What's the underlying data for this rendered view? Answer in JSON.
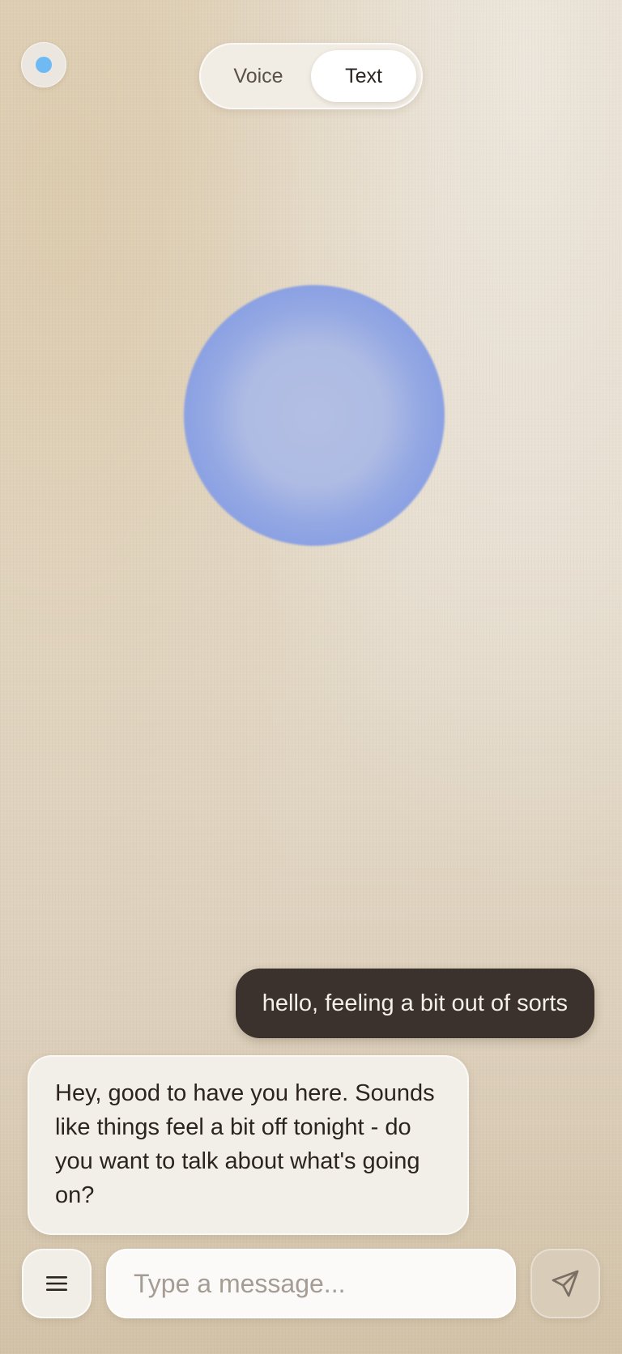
{
  "status": {
    "indicator_icon": "status-dot-icon",
    "color": "#6fbaf3"
  },
  "mode_toggle": {
    "tabs": [
      {
        "label": "Voice",
        "active": false
      },
      {
        "label": "Text",
        "active": true
      }
    ]
  },
  "conversation": {
    "messages": [
      {
        "role": "user",
        "text": "hello, feeling a bit out of sorts"
      },
      {
        "role": "assistant",
        "text": "Hey, good to have you here. Sounds like things feel a bit off tonight - do you want to talk about what's going on?"
      }
    ]
  },
  "composer": {
    "placeholder": "Type a message...",
    "value": "",
    "menu_icon": "hamburger-menu-icon",
    "send_icon": "send-icon"
  },
  "colors": {
    "orb": "#8aa0e3",
    "user_bubble": "#3b322d",
    "assistant_bubble": "#f2eee8",
    "accent_dot": "#6fbaf3"
  }
}
